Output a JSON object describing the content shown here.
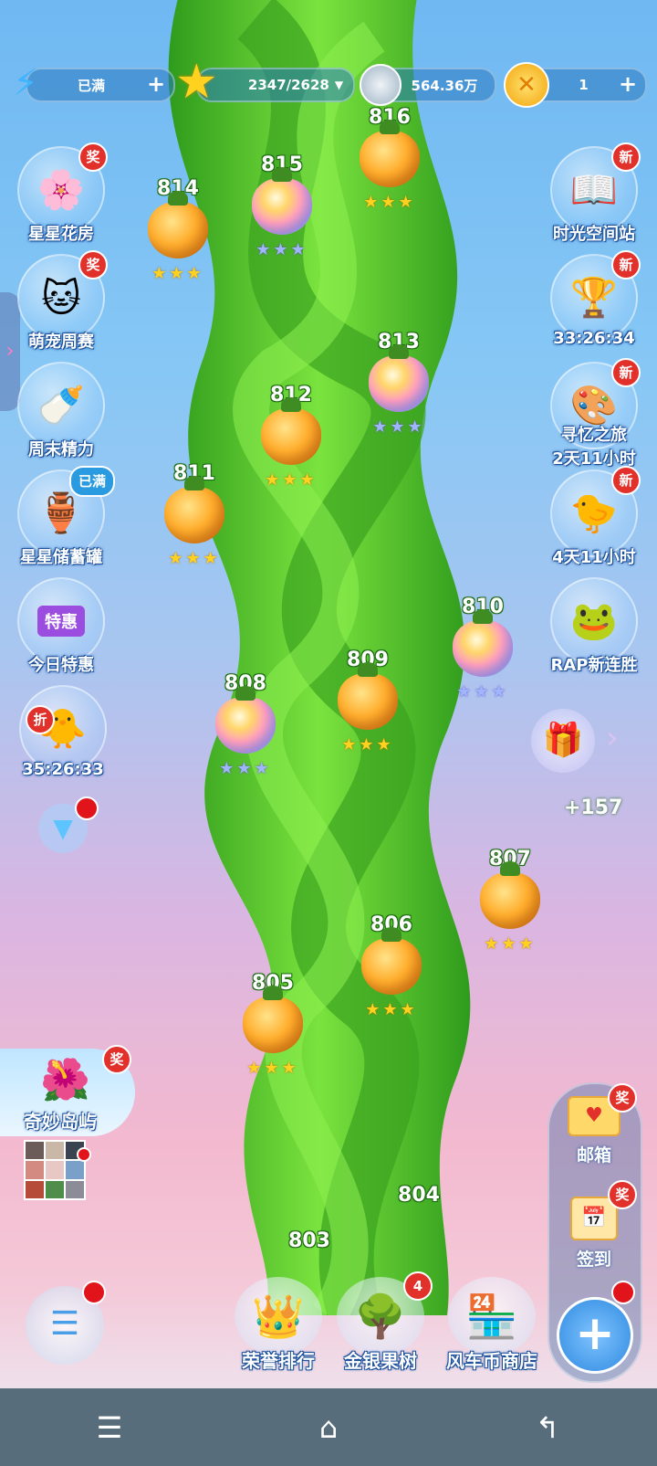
{
  "topbar": {
    "energy_label": "已满",
    "stars_label": "2347/2628",
    "coins_label": "564.36万",
    "tokens_label": "1"
  },
  "left_menu": [
    {
      "label": "星星花房",
      "badge": "奖",
      "icon": "flower-house-icon"
    },
    {
      "label": "萌宠周赛",
      "badge": "奖",
      "icon": "cat-pet-icon"
    },
    {
      "label": "周末精力",
      "badge": "",
      "icon": "energy-bottle-icon"
    },
    {
      "label": "星星储蓄罐",
      "badge": "已满",
      "icon": "star-jar-icon"
    },
    {
      "label": "今日特惠",
      "badge": "特惠",
      "icon": "sale-shop-icon"
    },
    {
      "label": "35:26:33",
      "badge": "折",
      "icon": "discount-chick-icon"
    }
  ],
  "right_menu": [
    {
      "label": "时光空间站",
      "badge": "新",
      "icon": "time-station-icon"
    },
    {
      "label": "33:26:34",
      "badge": "新",
      "icon": "trophy-20-icon"
    },
    {
      "label1": "寻忆之旅",
      "label2": "2天11小时",
      "badge": "新",
      "icon": "memory-journey-icon"
    },
    {
      "label": "4天11小时",
      "badge": "新",
      "icon": "chick-event-icon"
    },
    {
      "label": "RAP新连胜",
      "badge": "",
      "icon": "frog-rap-icon"
    }
  ],
  "side_counter": "+157",
  "island": {
    "label": "奇妙岛屿",
    "badge": "奖"
  },
  "levels": [
    {
      "num": "816",
      "type": "orange",
      "stars": "★★★"
    },
    {
      "num": "815",
      "type": "rainbow",
      "stars": "★★★"
    },
    {
      "num": "814",
      "type": "orange",
      "stars": "★★★"
    },
    {
      "num": "813",
      "type": "rainbow",
      "stars": "★★★"
    },
    {
      "num": "812",
      "type": "orange",
      "stars": "★★★"
    },
    {
      "num": "811",
      "type": "orange",
      "stars": "★★★"
    },
    {
      "num": "810",
      "type": "rainbow",
      "stars": "★★★"
    },
    {
      "num": "809",
      "type": "orange",
      "stars": "★★★"
    },
    {
      "num": "808",
      "type": "rainbow",
      "stars": "★★★"
    },
    {
      "num": "807",
      "type": "orange",
      "stars": "★★★"
    },
    {
      "num": "806",
      "type": "orange",
      "stars": "★★★"
    },
    {
      "num": "805",
      "type": "orange",
      "stars": "★★★"
    },
    {
      "num": "804",
      "type": "",
      "stars": ""
    },
    {
      "num": "803",
      "type": "",
      "stars": ""
    }
  ],
  "right_panel": {
    "mail_label": "邮箱",
    "mail_badge": "奖",
    "checkin_label": "签到",
    "checkin_badge": "奖",
    "plus": "+"
  },
  "bottom": {
    "rank_label": "荣誉排行",
    "tree_label": "金银果树",
    "tree_badge": "4",
    "shop_label": "风车币商店"
  },
  "colors": {
    "badge_red": "#e2312b",
    "stalk_green": "#4cc22a",
    "level_text": "#ffffff"
  }
}
